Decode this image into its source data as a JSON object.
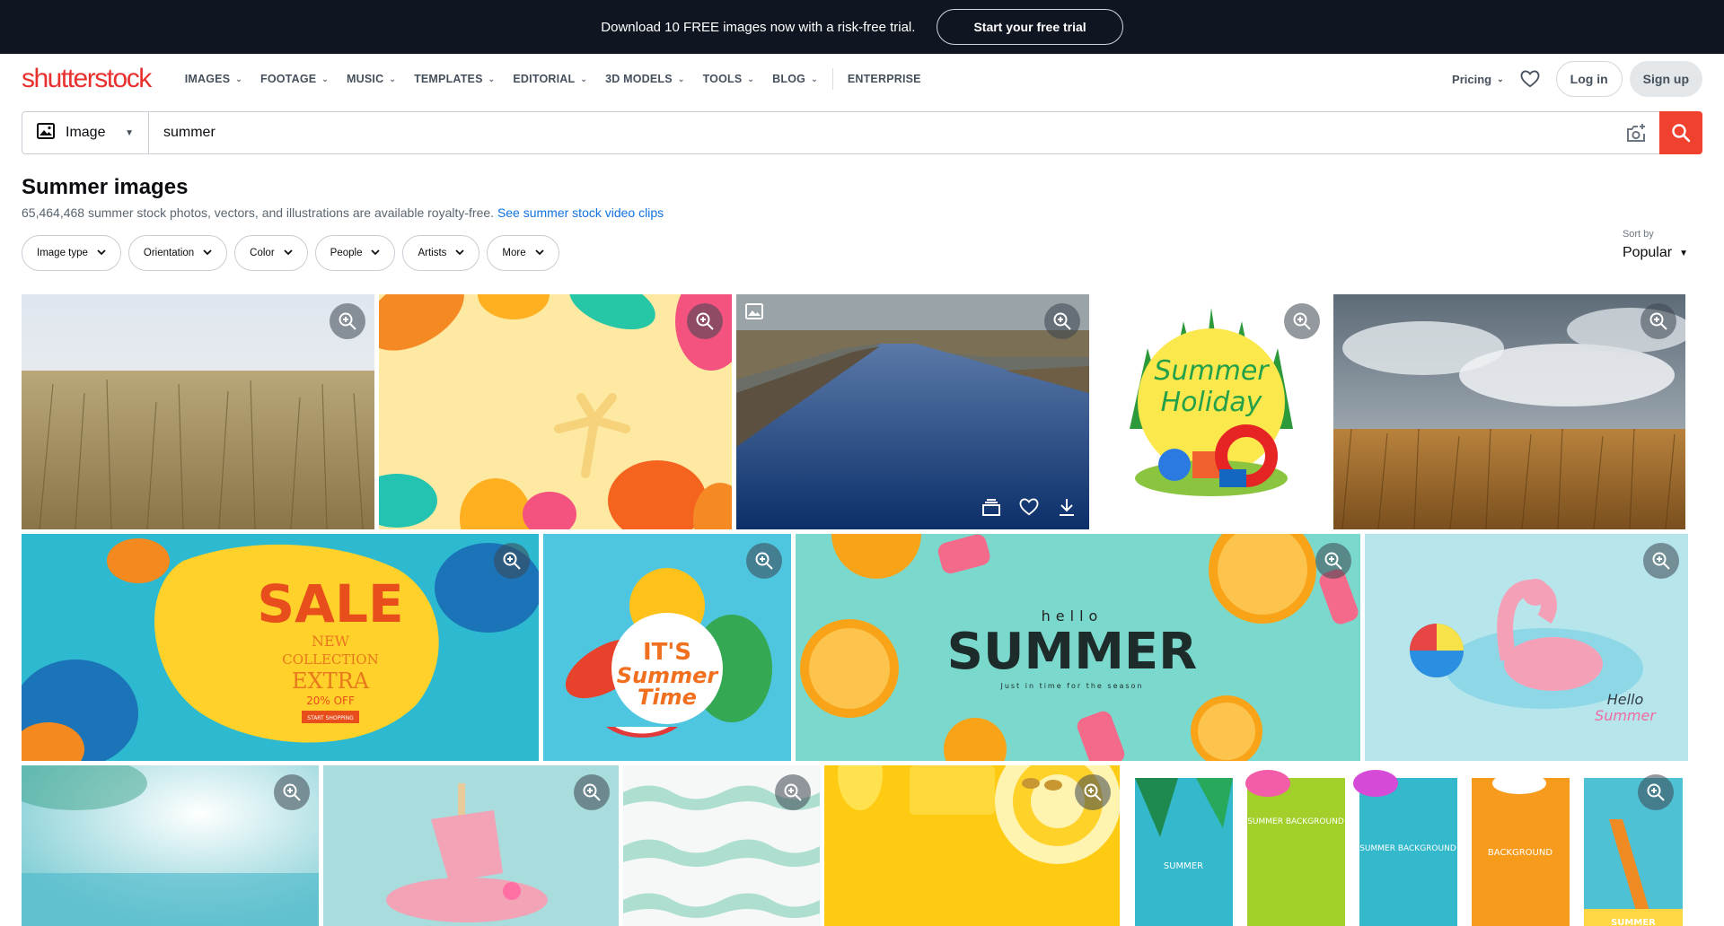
{
  "promo": {
    "text": "Download 10 FREE images now with a risk-free trial.",
    "cta": "Start your free trial"
  },
  "nav": {
    "logo": "shutterstock",
    "items": [
      {
        "label": "IMAGES",
        "has_menu": true
      },
      {
        "label": "FOOTAGE",
        "has_menu": true
      },
      {
        "label": "MUSIC",
        "has_menu": true
      },
      {
        "label": "TEMPLATES",
        "has_menu": true
      },
      {
        "label": "EDITORIAL",
        "has_menu": true
      },
      {
        "label": "3D MODELS",
        "has_menu": true
      },
      {
        "label": "TOOLS",
        "has_menu": true
      },
      {
        "label": "BLOG",
        "has_menu": true
      }
    ],
    "enterprise": "ENTERPRISE",
    "pricing": "Pricing",
    "login": "Log in",
    "signup": "Sign up"
  },
  "search": {
    "type": "Image",
    "query": "summer"
  },
  "heading": {
    "title": "Summer images",
    "subtitle": "65,464,468 summer stock photos, vectors, and illustrations are available royalty-free.",
    "link": "See summer stock video clips"
  },
  "filters": [
    "Image type",
    "Orientation",
    "Color",
    "People",
    "Artists",
    "More"
  ],
  "sort": {
    "label": "Sort by",
    "value": "Popular"
  },
  "colors": {
    "brand": "#e8302e",
    "search_button": "#f0412e",
    "promo_bg": "#0f1621",
    "link": "#0f73e0"
  },
  "images": [
    [
      "wheat-field-photo",
      "tropical-leaves-frame",
      "river-landscape-photo",
      "summer-holiday-illustration",
      "wheat-field-cloudy-sky-photo"
    ],
    [
      "summer-sale-banner",
      "its-summer-time-illustration",
      "hello-summer-oranges-banner",
      "flamingo-float-illustration"
    ],
    [
      "blurred-beach-palm-photo",
      "melting-popsicle-flamingo",
      "tie-dye-pattern",
      "yellow-beach-flatlay",
      "summer-background-stories"
    ]
  ],
  "image_text": {
    "holiday": [
      "Summer",
      "Holiday"
    ],
    "sale": [
      "SALE",
      "NEW",
      "COLLECTION",
      "EXTRA",
      "20% OFF",
      "START SHOPPING"
    ],
    "summer_time": [
      "IT'S",
      "Summer",
      "Time"
    ],
    "hello_summer": [
      "hello",
      "SUMMER",
      "Just in time for the season"
    ],
    "flamingo": [
      "Hello",
      "Summer"
    ],
    "stories": [
      "SUMMER",
      "SUMMER BACKGROUND",
      "SUMMER BACKGROUND",
      "BACKGROUND",
      "SUMMER"
    ]
  }
}
